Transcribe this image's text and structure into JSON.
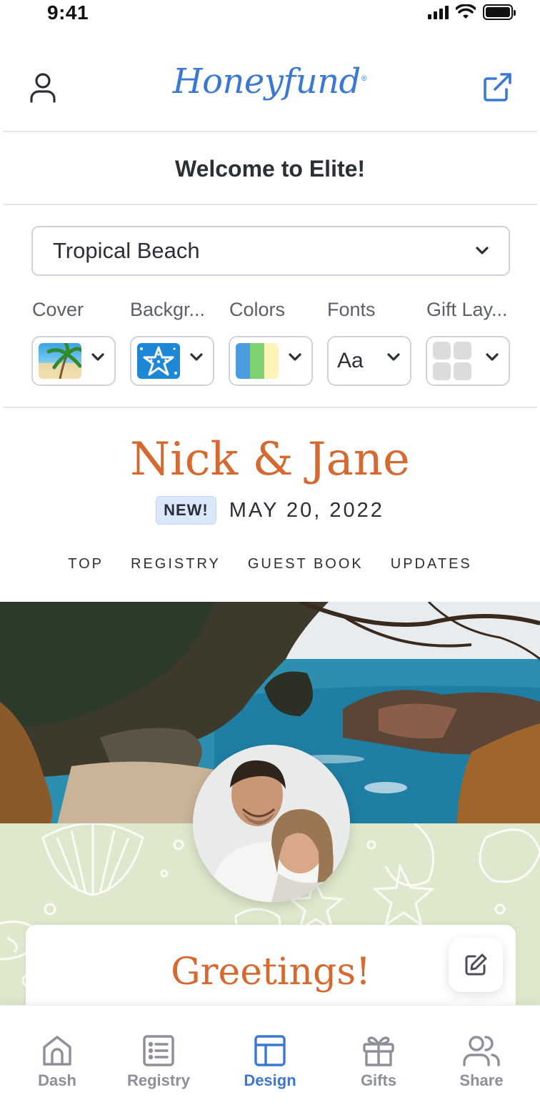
{
  "status_bar": {
    "time": "9:41"
  },
  "header": {
    "logo": "Honeyfund",
    "logo_mark": "®"
  },
  "welcome": "Welcome to Elite!",
  "theme_select": {
    "value": "Tropical Beach"
  },
  "design_options": [
    {
      "label": "Cover"
    },
    {
      "label": "Backgr..."
    },
    {
      "label": "Colors"
    },
    {
      "label": "Fonts",
      "sample": "Aa"
    },
    {
      "label": "Gift Lay..."
    }
  ],
  "preview": {
    "couple_names": "Nick & Jane",
    "badge": "NEW!",
    "date": "MAY 20, 2022",
    "nav": [
      "TOP",
      "REGISTRY",
      "GUEST BOOK",
      "UPDATES"
    ],
    "greeting": "Greetings!"
  },
  "tabs": [
    {
      "label": "Dash",
      "icon": "home-icon"
    },
    {
      "label": "Registry",
      "icon": "list-icon"
    },
    {
      "label": "Design",
      "icon": "layout-icon",
      "active": true
    },
    {
      "label": "Gifts",
      "icon": "gift-icon"
    },
    {
      "label": "Share",
      "icon": "users-icon"
    }
  ],
  "colors": {
    "brand": "#3a78d4",
    "accent": "#d5692f",
    "badge_bg": "#dbe7fb",
    "pattern_bg": "#dfe8cc"
  }
}
